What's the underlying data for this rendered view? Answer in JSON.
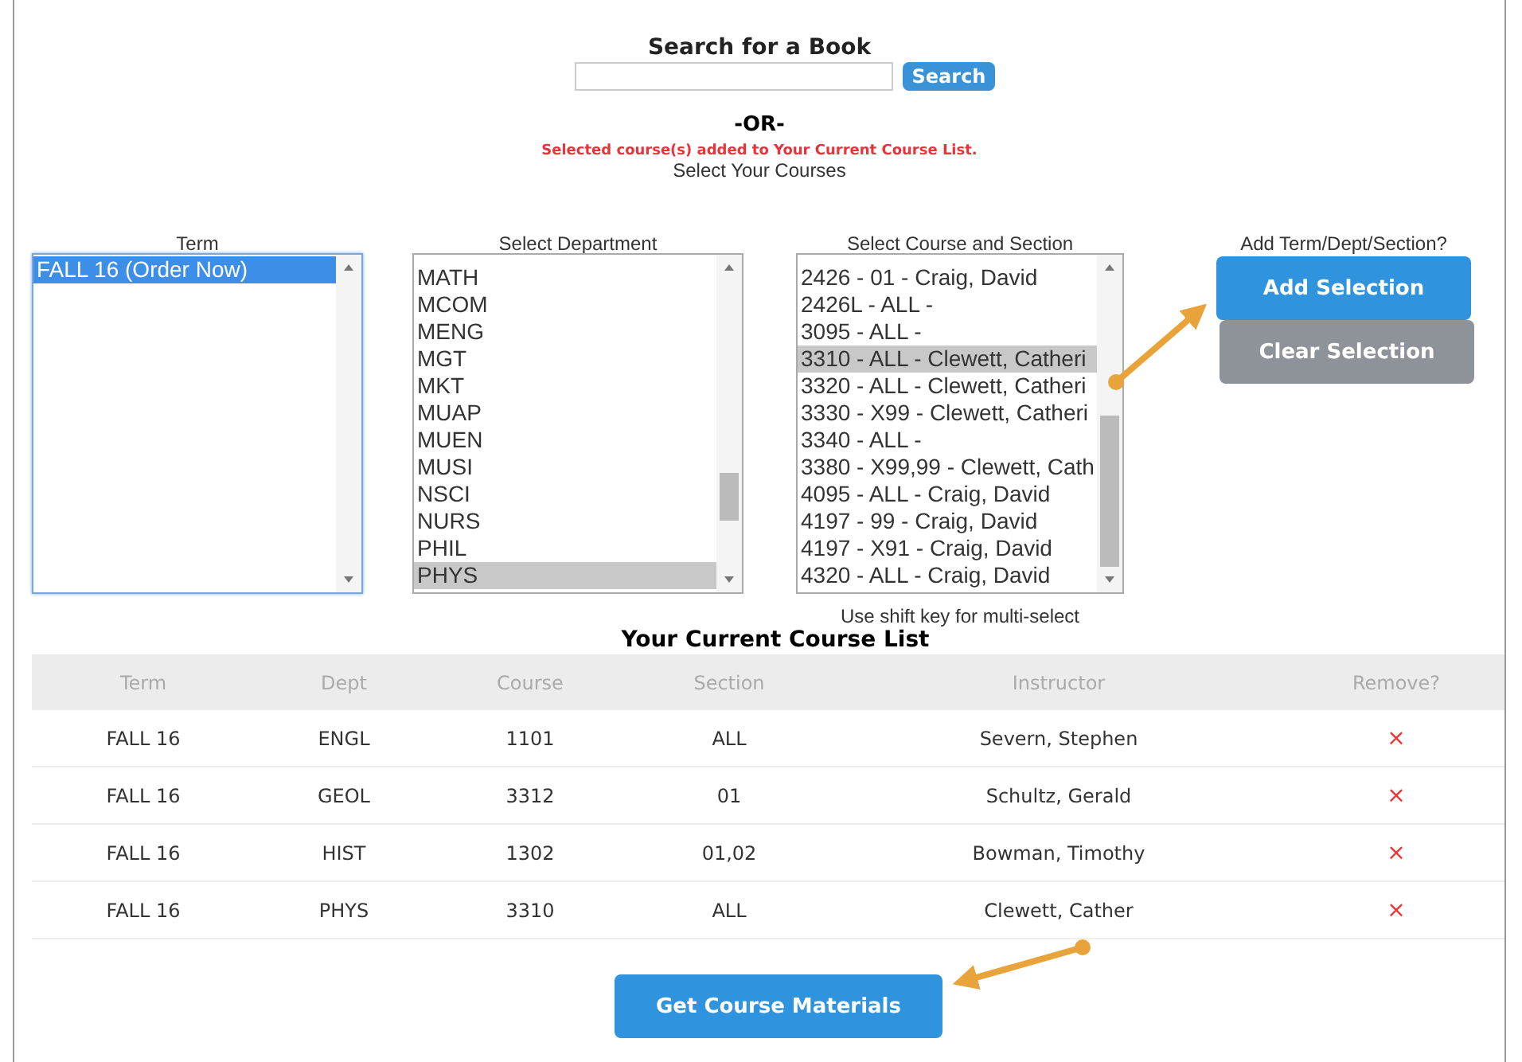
{
  "search": {
    "title": "Search for a Book",
    "button": "Search"
  },
  "or_text": "-OR-",
  "message": "Selected course(s) added to Your Current Course List.",
  "select_heading": "Select Your Courses",
  "lists": [
    {
      "label": "Term",
      "items": [
        {
          "text": "FALL 16 (Order Now)",
          "selected": true
        }
      ]
    },
    {
      "label": "Select Department",
      "items": [
        {
          "text": "MATH",
          "selected": false
        },
        {
          "text": "MCOM",
          "selected": false
        },
        {
          "text": "MENG",
          "selected": false
        },
        {
          "text": "MGT",
          "selected": false
        },
        {
          "text": "MKT",
          "selected": false
        },
        {
          "text": "MUAP",
          "selected": false
        },
        {
          "text": "MUEN",
          "selected": false
        },
        {
          "text": "MUSI",
          "selected": false
        },
        {
          "text": "NSCI",
          "selected": false
        },
        {
          "text": "NURS",
          "selected": false
        },
        {
          "text": "PHIL",
          "selected": false
        },
        {
          "text": "PHYS",
          "selected": true
        }
      ]
    },
    {
      "label": "Select Course and Section",
      "items": [
        {
          "text": "2426 - 01 - Craig, David",
          "selected": false
        },
        {
          "text": "2426L - ALL -",
          "selected": false
        },
        {
          "text": "3095 - ALL -",
          "selected": false
        },
        {
          "text": "3310 - ALL - Clewett, Catheri",
          "selected": true
        },
        {
          "text": "3320 - ALL - Clewett, Catheri",
          "selected": false
        },
        {
          "text": "3330 - X99 - Clewett, Catheri",
          "selected": false
        },
        {
          "text": "3340 - ALL -",
          "selected": false
        },
        {
          "text": "3380 - X99,99 - Clewett, Cath",
          "selected": false
        },
        {
          "text": "4095 - ALL - Craig, David",
          "selected": false
        },
        {
          "text": "4197 - 99 - Craig, David",
          "selected": false
        },
        {
          "text": "4197 - X91 - Craig, David",
          "selected": false
        },
        {
          "text": "4320 - ALL - Craig, David",
          "selected": false
        }
      ]
    }
  ],
  "hint": "Use shift key for multi-select",
  "add_prompt": "Add Term/Dept/Section?",
  "buttons": [
    {
      "label": "Add Selection",
      "kind": "primary"
    },
    {
      "label": "Clear Selection",
      "kind": "secondary"
    }
  ],
  "table": {
    "title": "Your Current Course List",
    "columns": [
      "Term",
      "Dept",
      "Course",
      "Section",
      "Instructor",
      "Remove?"
    ],
    "rows": [
      {
        "cells": [
          "FALL 16",
          "ENGL",
          "1101",
          "ALL",
          "Severn, Stephen"
        ],
        "remove": "×"
      },
      {
        "cells": [
          "FALL 16",
          "GEOL",
          "3312",
          "01",
          "Schultz, Gerald"
        ],
        "remove": "×"
      },
      {
        "cells": [
          "FALL 16",
          "HIST",
          "1302",
          "01,02",
          "Bowman, Timothy"
        ],
        "remove": "×"
      },
      {
        "cells": [
          "FALL 16",
          "PHYS",
          "3310",
          "ALL",
          "Clewett, Cather"
        ],
        "remove": "×"
      }
    ]
  },
  "materials_button": "Get Course Materials"
}
